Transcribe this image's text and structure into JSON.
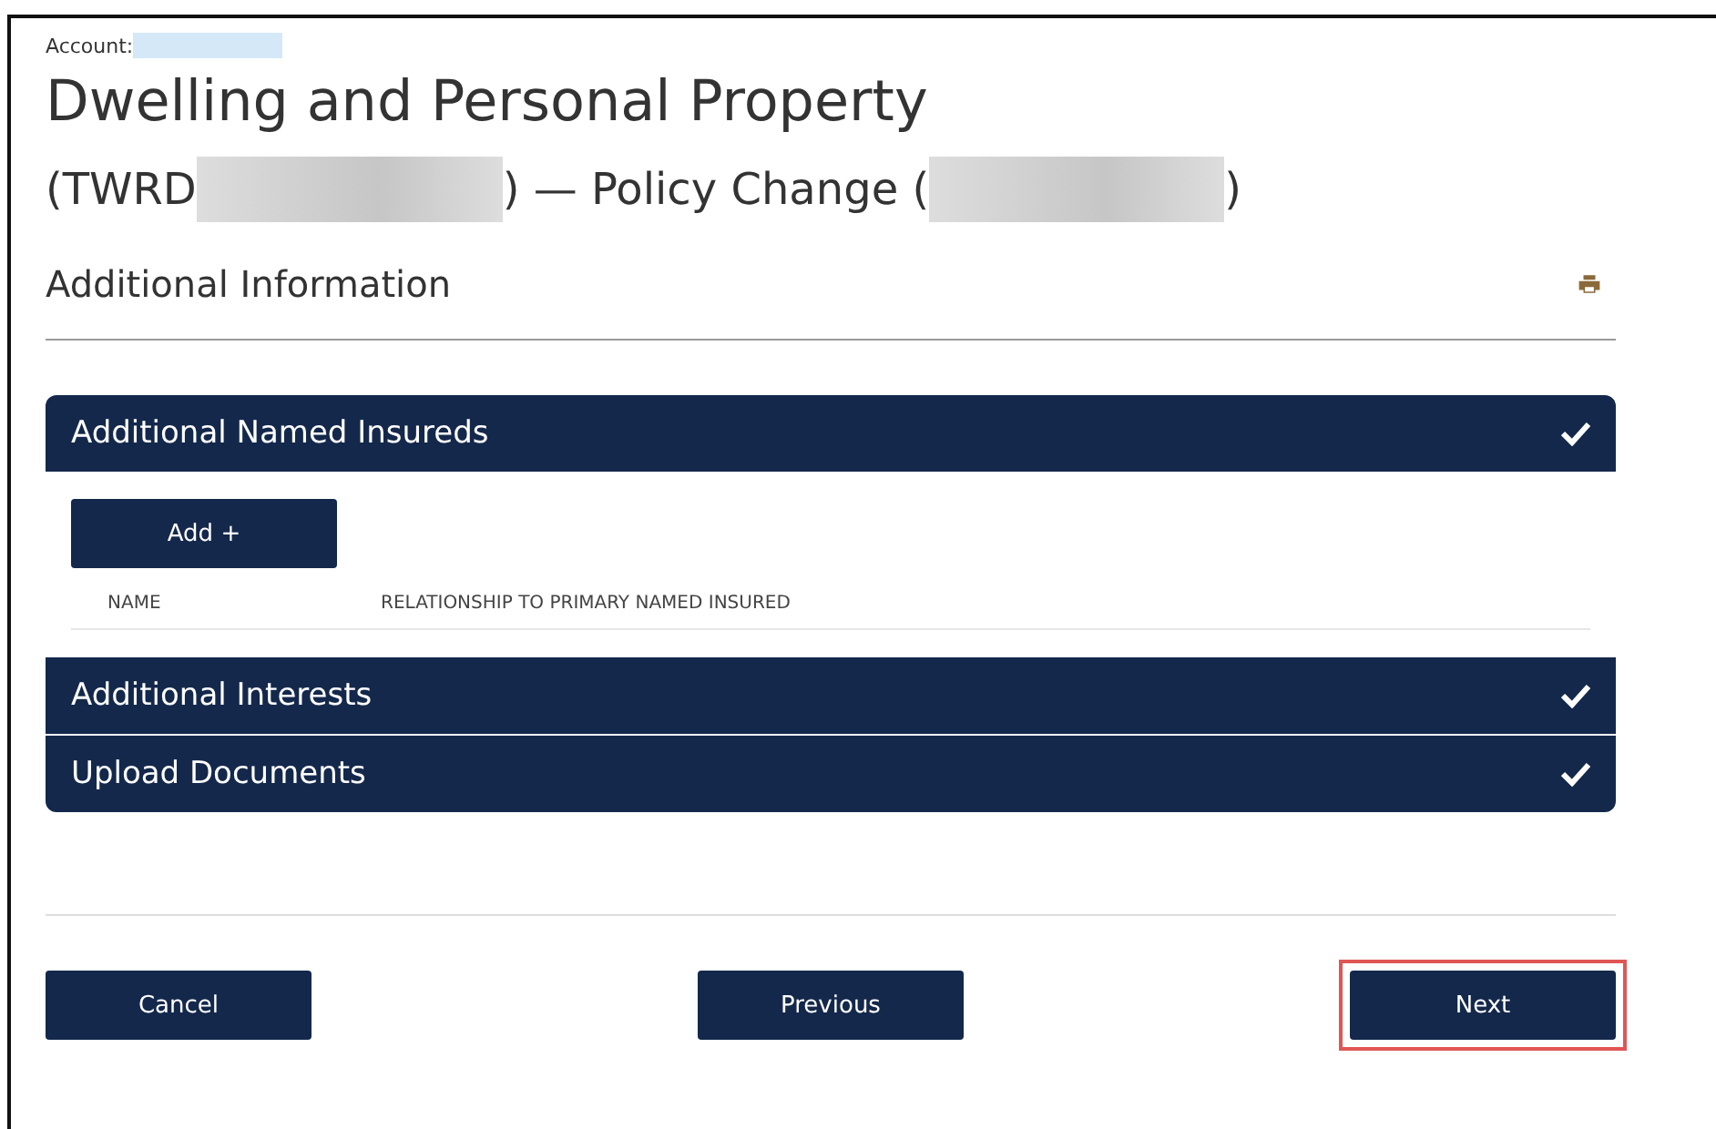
{
  "account": {
    "label": "Account:"
  },
  "title": "Dwelling and Personal Property",
  "subtitle": {
    "parts": [
      "(TWRD",
      ") — Policy Change (",
      ")"
    ]
  },
  "page_heading": "Additional Information",
  "sections": [
    {
      "title": "Additional Named Insureds",
      "completed": true,
      "expanded": true,
      "add_button": "Add +",
      "columns": [
        "NAME",
        "RELATIONSHIP TO PRIMARY NAMED INSURED"
      ]
    },
    {
      "title": "Additional Interests",
      "completed": true,
      "expanded": false
    },
    {
      "title": "Upload Documents",
      "completed": true,
      "expanded": false
    }
  ],
  "buttons": [
    {
      "label": "Cancel",
      "highlighted": false
    },
    {
      "label": "Previous",
      "highlighted": false
    },
    {
      "label": "Next",
      "highlighted": true
    }
  ]
}
